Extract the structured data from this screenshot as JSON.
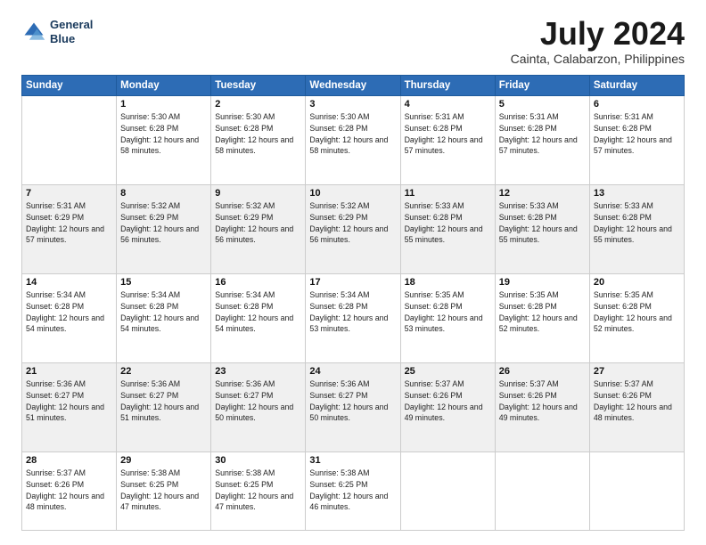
{
  "header": {
    "logo_line1": "General",
    "logo_line2": "Blue",
    "month": "July 2024",
    "location": "Cainta, Calabarzon, Philippines"
  },
  "days_of_week": [
    "Sunday",
    "Monday",
    "Tuesday",
    "Wednesday",
    "Thursday",
    "Friday",
    "Saturday"
  ],
  "weeks": [
    [
      {
        "num": "",
        "info": ""
      },
      {
        "num": "1",
        "info": "Sunrise: 5:30 AM\nSunset: 6:28 PM\nDaylight: 12 hours\nand 58 minutes."
      },
      {
        "num": "2",
        "info": "Sunrise: 5:30 AM\nSunset: 6:28 PM\nDaylight: 12 hours\nand 58 minutes."
      },
      {
        "num": "3",
        "info": "Sunrise: 5:30 AM\nSunset: 6:28 PM\nDaylight: 12 hours\nand 58 minutes."
      },
      {
        "num": "4",
        "info": "Sunrise: 5:31 AM\nSunset: 6:28 PM\nDaylight: 12 hours\nand 57 minutes."
      },
      {
        "num": "5",
        "info": "Sunrise: 5:31 AM\nSunset: 6:28 PM\nDaylight: 12 hours\nand 57 minutes."
      },
      {
        "num": "6",
        "info": "Sunrise: 5:31 AM\nSunset: 6:28 PM\nDaylight: 12 hours\nand 57 minutes."
      }
    ],
    [
      {
        "num": "7",
        "info": "Sunrise: 5:31 AM\nSunset: 6:29 PM\nDaylight: 12 hours\nand 57 minutes."
      },
      {
        "num": "8",
        "info": "Sunrise: 5:32 AM\nSunset: 6:29 PM\nDaylight: 12 hours\nand 56 minutes."
      },
      {
        "num": "9",
        "info": "Sunrise: 5:32 AM\nSunset: 6:29 PM\nDaylight: 12 hours\nand 56 minutes."
      },
      {
        "num": "10",
        "info": "Sunrise: 5:32 AM\nSunset: 6:29 PM\nDaylight: 12 hours\nand 56 minutes."
      },
      {
        "num": "11",
        "info": "Sunrise: 5:33 AM\nSunset: 6:28 PM\nDaylight: 12 hours\nand 55 minutes."
      },
      {
        "num": "12",
        "info": "Sunrise: 5:33 AM\nSunset: 6:28 PM\nDaylight: 12 hours\nand 55 minutes."
      },
      {
        "num": "13",
        "info": "Sunrise: 5:33 AM\nSunset: 6:28 PM\nDaylight: 12 hours\nand 55 minutes."
      }
    ],
    [
      {
        "num": "14",
        "info": "Sunrise: 5:34 AM\nSunset: 6:28 PM\nDaylight: 12 hours\nand 54 minutes."
      },
      {
        "num": "15",
        "info": "Sunrise: 5:34 AM\nSunset: 6:28 PM\nDaylight: 12 hours\nand 54 minutes."
      },
      {
        "num": "16",
        "info": "Sunrise: 5:34 AM\nSunset: 6:28 PM\nDaylight: 12 hours\nand 54 minutes."
      },
      {
        "num": "17",
        "info": "Sunrise: 5:34 AM\nSunset: 6:28 PM\nDaylight: 12 hours\nand 53 minutes."
      },
      {
        "num": "18",
        "info": "Sunrise: 5:35 AM\nSunset: 6:28 PM\nDaylight: 12 hours\nand 53 minutes."
      },
      {
        "num": "19",
        "info": "Sunrise: 5:35 AM\nSunset: 6:28 PM\nDaylight: 12 hours\nand 52 minutes."
      },
      {
        "num": "20",
        "info": "Sunrise: 5:35 AM\nSunset: 6:28 PM\nDaylight: 12 hours\nand 52 minutes."
      }
    ],
    [
      {
        "num": "21",
        "info": "Sunrise: 5:36 AM\nSunset: 6:27 PM\nDaylight: 12 hours\nand 51 minutes."
      },
      {
        "num": "22",
        "info": "Sunrise: 5:36 AM\nSunset: 6:27 PM\nDaylight: 12 hours\nand 51 minutes."
      },
      {
        "num": "23",
        "info": "Sunrise: 5:36 AM\nSunset: 6:27 PM\nDaylight: 12 hours\nand 50 minutes."
      },
      {
        "num": "24",
        "info": "Sunrise: 5:36 AM\nSunset: 6:27 PM\nDaylight: 12 hours\nand 50 minutes."
      },
      {
        "num": "25",
        "info": "Sunrise: 5:37 AM\nSunset: 6:26 PM\nDaylight: 12 hours\nand 49 minutes."
      },
      {
        "num": "26",
        "info": "Sunrise: 5:37 AM\nSunset: 6:26 PM\nDaylight: 12 hours\nand 49 minutes."
      },
      {
        "num": "27",
        "info": "Sunrise: 5:37 AM\nSunset: 6:26 PM\nDaylight: 12 hours\nand 48 minutes."
      }
    ],
    [
      {
        "num": "28",
        "info": "Sunrise: 5:37 AM\nSunset: 6:26 PM\nDaylight: 12 hours\nand 48 minutes."
      },
      {
        "num": "29",
        "info": "Sunrise: 5:38 AM\nSunset: 6:25 PM\nDaylight: 12 hours\nand 47 minutes."
      },
      {
        "num": "30",
        "info": "Sunrise: 5:38 AM\nSunset: 6:25 PM\nDaylight: 12 hours\nand 47 minutes."
      },
      {
        "num": "31",
        "info": "Sunrise: 5:38 AM\nSunset: 6:25 PM\nDaylight: 12 hours\nand 46 minutes."
      },
      {
        "num": "",
        "info": ""
      },
      {
        "num": "",
        "info": ""
      },
      {
        "num": "",
        "info": ""
      }
    ]
  ]
}
